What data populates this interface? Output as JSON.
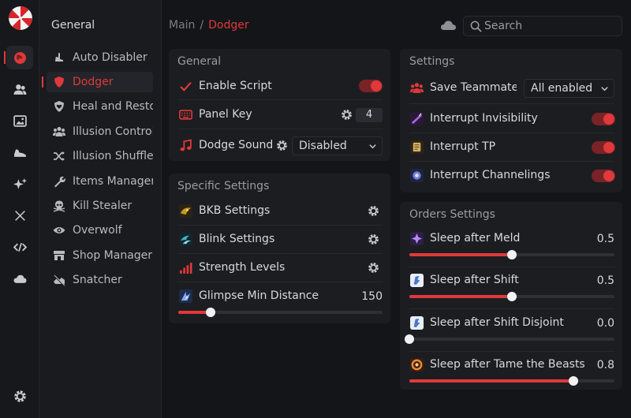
{
  "rail": {
    "items": [
      {
        "name": "globe-icon",
        "active": true
      },
      {
        "name": "users-icon"
      },
      {
        "name": "image-icon"
      },
      {
        "name": "shoe-icon"
      },
      {
        "name": "sparkle-icon"
      },
      {
        "name": "tools-icon"
      },
      {
        "name": "code-icon"
      },
      {
        "name": "cloud-icon"
      }
    ],
    "bottom": "gear-icon"
  },
  "sidebar": {
    "title": "General",
    "items": [
      {
        "label": "Auto Disabler",
        "icon": "hand-icon"
      },
      {
        "label": "Dodger",
        "icon": "shield-icon",
        "active": true
      },
      {
        "label": "Heal and Restore",
        "icon": "heart-shield-icon"
      },
      {
        "label": "Illusion Controller",
        "icon": "group-icon"
      },
      {
        "label": "Illusion Shuffler",
        "icon": "shuffle-icon"
      },
      {
        "label": "Items Manager",
        "icon": "wrench-icon"
      },
      {
        "label": "Kill Stealer",
        "icon": "skull-icon"
      },
      {
        "label": "Overwolf",
        "icon": "eye-icon"
      },
      {
        "label": "Shop Manager",
        "icon": "shop-icon"
      },
      {
        "label": "Snatcher",
        "icon": "hand-grab-icon"
      }
    ]
  },
  "header": {
    "breadcrumb_root": "Main",
    "breadcrumb_sep": "/",
    "breadcrumb_current": "Dodger",
    "search_placeholder": "Search"
  },
  "general": {
    "title": "General",
    "enable_script_label": "Enable Script",
    "enable_script_on": true,
    "panel_key_label": "Panel Key",
    "panel_key_value": "4",
    "dodge_sound_label": "Dodge Sound",
    "dodge_sound_value": "Disabled"
  },
  "specific": {
    "title": "Specific Settings",
    "bkb_label": "BKB Settings",
    "blink_label": "Blink Settings",
    "strength_label": "Strength Levels",
    "glimpse_label": "Glimpse Min Distance",
    "glimpse_value": "150",
    "glimpse_fraction": 0.16
  },
  "settings": {
    "title": "Settings",
    "save_teammates_label": "Save Teammates",
    "save_teammates_value": "All enabled",
    "interrupt_invis_label": "Interrupt Invisibility",
    "interrupt_tp_label": "Interrupt TP",
    "interrupt_channel_label": "Interrupt Channelings"
  },
  "orders": {
    "title": "Orders Settings",
    "items": [
      {
        "label": "Sleep after Meld",
        "value": "0.5",
        "fraction": 0.5
      },
      {
        "label": "Sleep after Shift",
        "value": "0.5",
        "fraction": 0.5
      },
      {
        "label": "Sleep after Shift Disjoint",
        "value": "0.0",
        "fraction": 0.0
      },
      {
        "label": "Sleep after Tame the Beasts",
        "value": "0.8",
        "fraction": 0.8
      }
    ]
  },
  "colors": {
    "accent": "#e0393b",
    "background": "#141518",
    "panel": "#1c1d21"
  }
}
